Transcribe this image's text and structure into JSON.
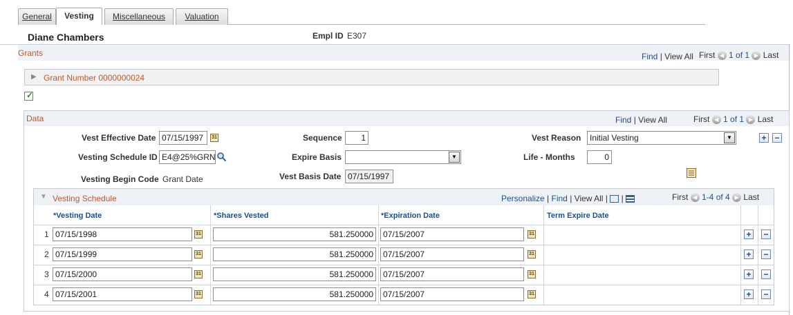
{
  "tabs": [
    {
      "label": "General",
      "active": false
    },
    {
      "label": "Vesting",
      "active": true
    },
    {
      "label": "Miscellaneous",
      "active": false
    },
    {
      "label": "Valuation",
      "active": false
    }
  ],
  "header": {
    "name": "Diane Chambers",
    "empl_id_label": "Empl ID",
    "empl_id": "E307"
  },
  "grants": {
    "title": "Grants",
    "find": "Find",
    "view_all": "View All",
    "first": "First",
    "count": "1 of 1",
    "last": "Last",
    "grant_number_label": "Grant Number 0000000024"
  },
  "data_section": {
    "title": "Data",
    "find": "Find",
    "view_all": "View All",
    "first": "First",
    "count": "1 of 1",
    "last": "Last",
    "vest_effective_date_label": "Vest Effective Date",
    "vest_effective_date": "07/15/1997",
    "sequence_label": "Sequence",
    "sequence": "1",
    "vest_reason_label": "Vest Reason",
    "vest_reason": "Initial Vesting",
    "vesting_schedule_id_label": "Vesting Schedule ID",
    "vesting_schedule_id": "E4@25%GRN",
    "expire_basis_label": "Expire Basis",
    "expire_basis": "",
    "life_months_label": "Life - Months",
    "life_months": "0",
    "vesting_begin_code_label": "Vesting Begin Code",
    "vesting_begin_code": "Grant Date",
    "vest_basis_date_label": "Vest Basis Date",
    "vest_basis_date": "07/15/1997"
  },
  "vesting_schedule": {
    "title": "Vesting Schedule",
    "personalize": "Personalize",
    "find": "Find",
    "view_all": "View All",
    "first": "First",
    "count": "1-4 of 4",
    "last": "Last",
    "columns": [
      "*Vesting Date",
      "*Shares Vested",
      "*Expiration Date",
      "Term Expire Date"
    ],
    "rows": [
      {
        "num": "1",
        "vesting_date": "07/15/1998",
        "shares": "581.250000",
        "expiration": "07/15/2007"
      },
      {
        "num": "2",
        "vesting_date": "07/15/1999",
        "shares": "581.250000",
        "expiration": "07/15/2007"
      },
      {
        "num": "3",
        "vesting_date": "07/15/2000",
        "shares": "581.250000",
        "expiration": "07/15/2007"
      },
      {
        "num": "4",
        "vesting_date": "07/15/2001",
        "shares": "581.250000",
        "expiration": "07/15/2007"
      }
    ]
  },
  "icons": {
    "calendar": "calendar-icon",
    "lookup": "magnifier-icon",
    "add": "plus",
    "delete": "minus"
  }
}
